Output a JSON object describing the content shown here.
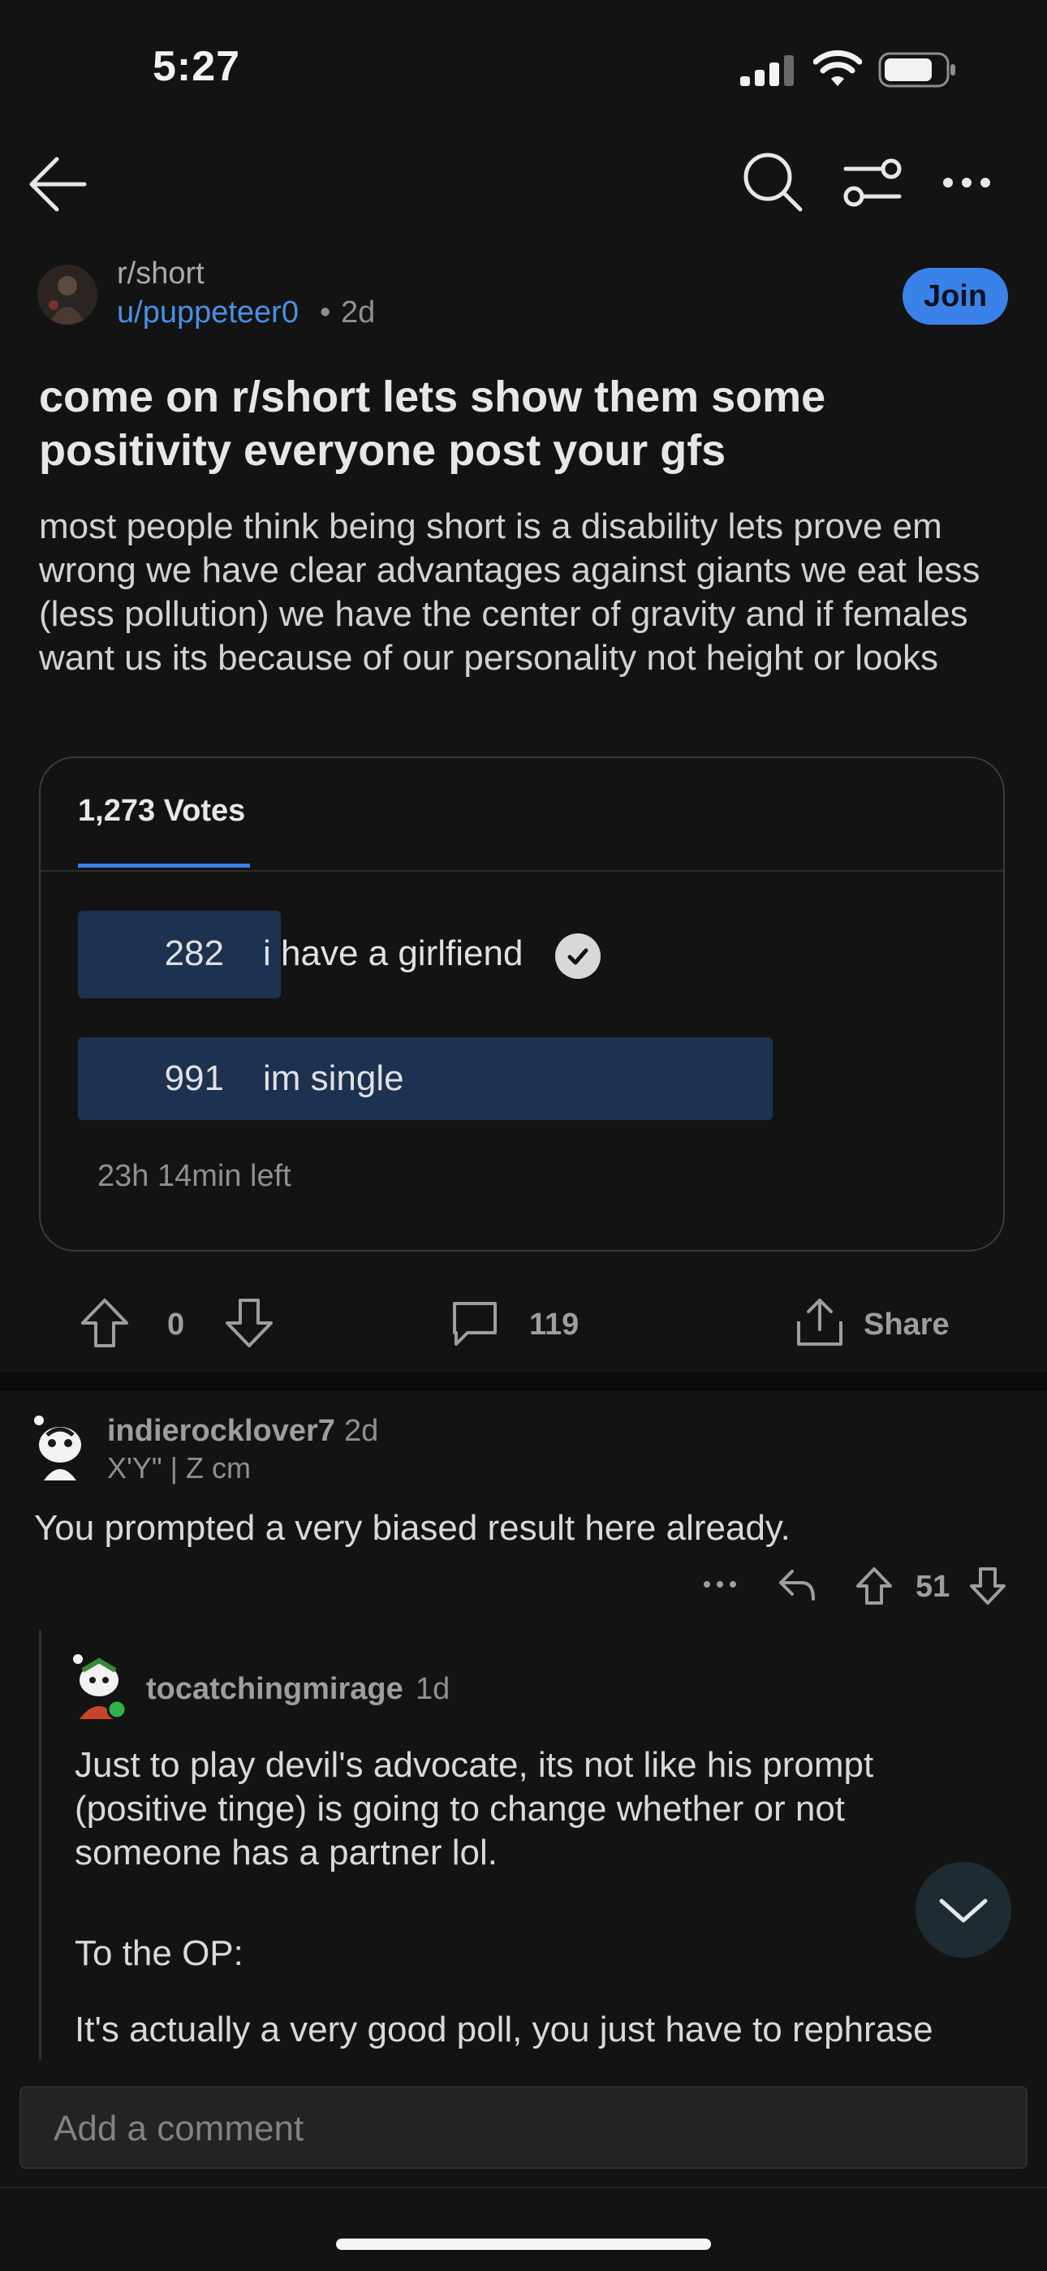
{
  "status_bar": {
    "time": "5:27"
  },
  "nav": {
    "back_icon": "arrow-left-icon",
    "search_icon": "search-icon",
    "sort_icon": "sort-icon",
    "more_icon": "more-horizontal-icon"
  },
  "post": {
    "subreddit": "r/short",
    "author": "u/puppeteer0",
    "separator": "•",
    "age": "2d",
    "join_label": "Join",
    "title": "come on r/short lets show them some positivity everyone post your gfs",
    "body": "most people think being short is a disability lets prove em wrong we have clear advantages against giants we eat less (less pollution) we have the center of gravity and if females want us its because of our personality not height or looks"
  },
  "poll": {
    "total_votes_label": "1,273 Votes",
    "options": [
      {
        "count": "282",
        "label": "i have a girlfiend",
        "fraction": 0.22,
        "selected": true
      },
      {
        "count": "991",
        "label": "im single",
        "fraction": 0.78,
        "selected": false
      }
    ],
    "time_left": "23h 14min left"
  },
  "actions": {
    "score": "0",
    "comments": "119",
    "share_label": "Share"
  },
  "comments": [
    {
      "user": "indierocklover7",
      "age": "2d",
      "flair": "X'Y\" | Z cm",
      "text": "You prompted a very biased result here already.",
      "score": "51"
    },
    {
      "user": "tocatchingmirage",
      "age": "1d",
      "paragraphs": [
        "Just to play devil's advocate, its not like his prompt (positive tinge) is going to change whether or not someone has a partner lol.",
        "To the OP:",
        "It's actually a very good poll, you just have to rephrase and change a few things."
      ]
    }
  ],
  "comment_input": {
    "placeholder": "Add a comment"
  },
  "colors": {
    "accent": "#3b82e8",
    "background": "#131314",
    "poll_bar": "#1d3150"
  }
}
